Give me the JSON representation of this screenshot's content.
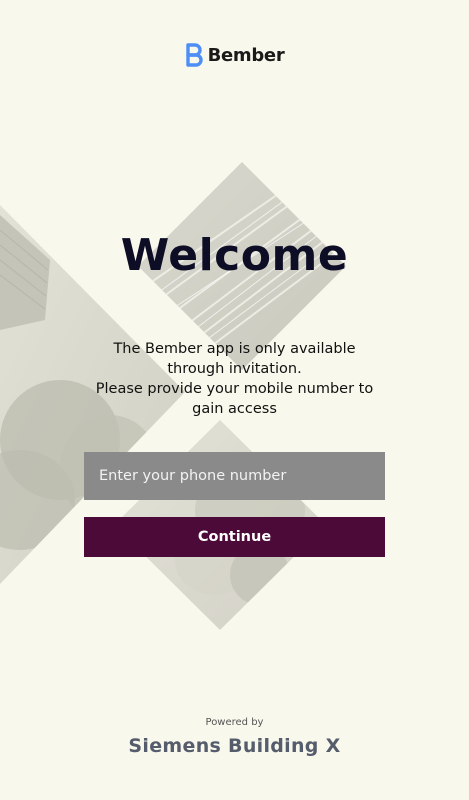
{
  "brand": {
    "name": "Bember",
    "accent_color": "#4d8ef7",
    "logo_icon": "bember-logo-icon"
  },
  "welcome": {
    "title": "Welcome",
    "message_lines": [
      "The Bember app is only available",
      "through invitation.",
      "Please provide your mobile number to",
      "gain access"
    ]
  },
  "phone": {
    "placeholder": "Enter your phone number",
    "value": ""
  },
  "continue_label": "Continue",
  "footer": {
    "powered_by": "Powered by",
    "provider": "Siemens Building X"
  },
  "colors": {
    "background": "#f9f8ec",
    "button": "#4b0a37",
    "input": "#8a8a8a",
    "title": "#0d0d26"
  }
}
